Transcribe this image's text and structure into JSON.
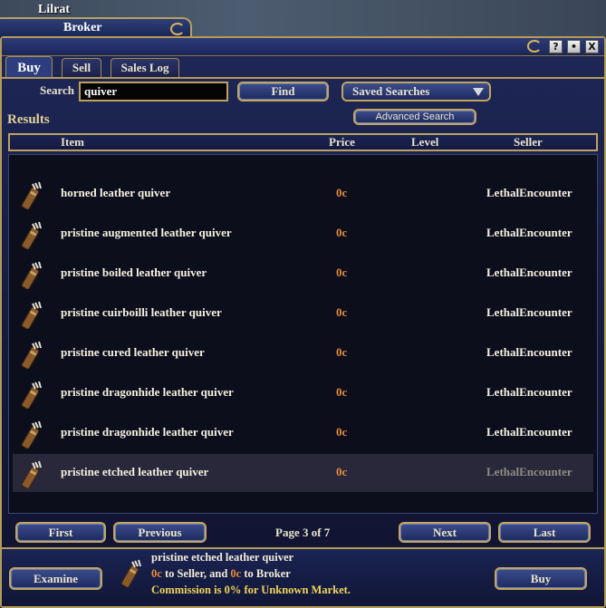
{
  "window": {
    "owner": "Lilrat",
    "title": "Broker",
    "buttons": [
      "?",
      "•",
      "X"
    ]
  },
  "tabs": [
    {
      "label": "Buy",
      "active": true
    },
    {
      "label": "Sell",
      "active": false
    },
    {
      "label": "Sales Log",
      "active": false
    }
  ],
  "search": {
    "label": "Search",
    "value": "quiver",
    "find_label": "Find",
    "saved_searches_label": "Saved Searches",
    "advanced_label": "Advanced Search"
  },
  "results": {
    "label": "Results",
    "columns": {
      "item": "Item",
      "price": "Price",
      "level": "Level",
      "seller": "Seller"
    },
    "rows": [
      {
        "item": "horned leather quiver",
        "price": "0c",
        "level": "",
        "seller": "LethalEncounter",
        "selected": false
      },
      {
        "item": "pristine augmented leather quiver",
        "price": "0c",
        "level": "",
        "seller": "LethalEncounter",
        "selected": false
      },
      {
        "item": "pristine boiled leather quiver",
        "price": "0c",
        "level": "",
        "seller": "LethalEncounter",
        "selected": false
      },
      {
        "item": "pristine cuirboilli leather quiver",
        "price": "0c",
        "level": "",
        "seller": "LethalEncounter",
        "selected": false
      },
      {
        "item": "pristine cured leather quiver",
        "price": "0c",
        "level": "",
        "seller": "LethalEncounter",
        "selected": false
      },
      {
        "item": "pristine dragonhide leather quiver",
        "price": "0c",
        "level": "",
        "seller": "LethalEncounter",
        "selected": false
      },
      {
        "item": "pristine dragonhide leather quiver",
        "price": "0c",
        "level": "",
        "seller": "LethalEncounter",
        "selected": false
      },
      {
        "item": "pristine etched leather quiver",
        "price": "0c",
        "level": "",
        "seller": "LethalEncounter",
        "selected": true
      }
    ],
    "item_icon": "quiver-icon"
  },
  "pagination": {
    "first_label": "First",
    "previous_label": "Previous",
    "page_text": "Page 3 of 7",
    "next_label": "Next",
    "last_label": "Last"
  },
  "footer": {
    "examine_label": "Examine",
    "buy_label": "Buy",
    "item_name": "pristine etched leather quiver",
    "seller_amount": "0c",
    "seller_text": " to Seller, and ",
    "broker_amount": "0c",
    "broker_text": " to Broker",
    "commission_text": "Commission is 0% for Unknown Market."
  },
  "colors": {
    "frame_border": "#b59b57",
    "price": "#e48a3b",
    "commission": "#f1d45c"
  }
}
